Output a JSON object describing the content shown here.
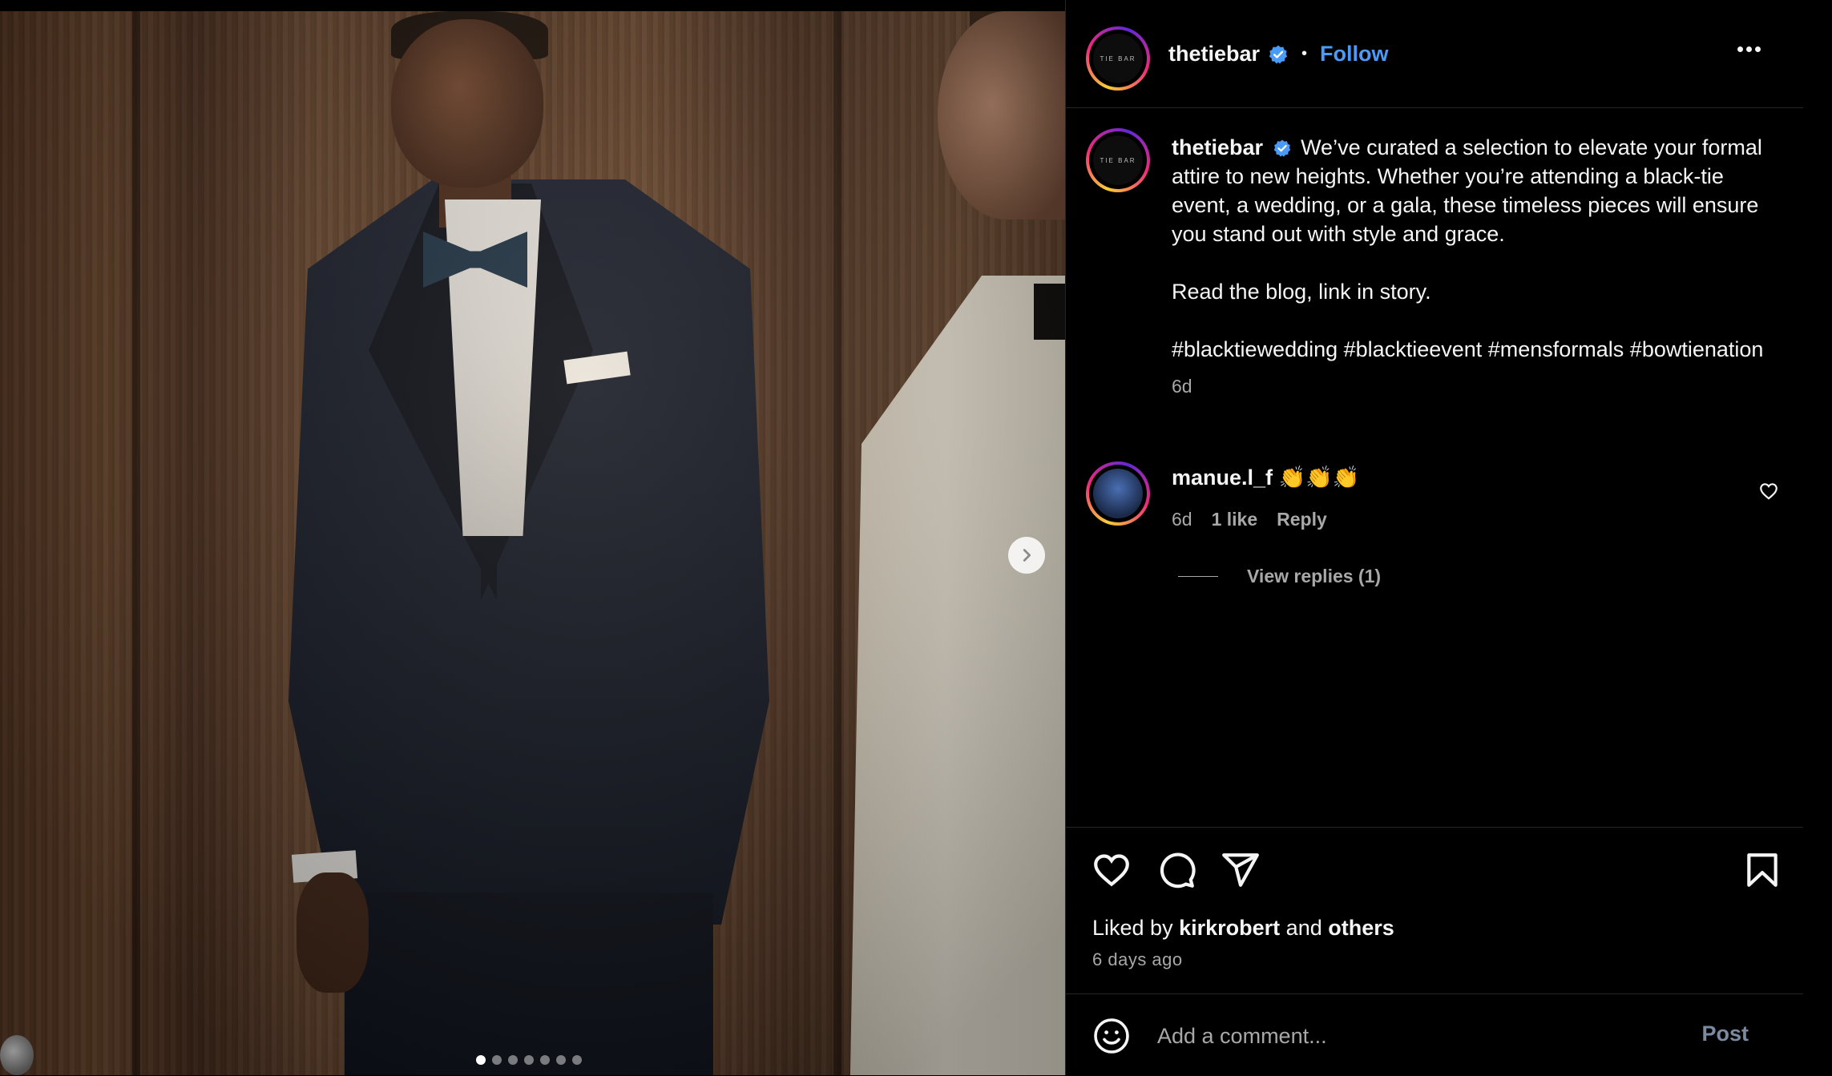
{
  "post": {
    "username": "thetiebar",
    "avatar_text": "TIE BAR",
    "follow_label": "Follow",
    "separator": "•",
    "caption_paragraphs": [
      "We’ve curated a selection to elevate your formal attire to new heights. Whether you’re attending a black-tie event, a wedding, or a gala, these timeless pieces will ensure you stand out with style and grace.",
      "Read the blog, link in story.",
      "#blacktiewedding #blacktieevent #mensformals #bowtienation"
    ],
    "caption_time": "6d",
    "carousel": {
      "total_slides": 7,
      "active_index": 0
    }
  },
  "comment": {
    "username": "manue.l_f",
    "text": "👏👏👏",
    "time": "6d",
    "likes": "1 like",
    "reply_label": "Reply",
    "view_replies": "View replies (1)"
  },
  "footer": {
    "liked_prefix": "Liked by",
    "liked_user": "kirkrobert",
    "liked_and": "and",
    "liked_others": "others",
    "date": "6 days ago",
    "comment_placeholder": "Add a comment...",
    "post_label": "Post"
  },
  "colors": {
    "accent": "#4a9bf7",
    "background": "#000000",
    "secondary_text": "#a8a8a8"
  },
  "icons": [
    "like-icon",
    "comment-icon",
    "share-icon",
    "save-icon",
    "emoji-icon",
    "more-icon",
    "verified-icon",
    "chevron-right-icon",
    "heart-small-icon"
  ]
}
